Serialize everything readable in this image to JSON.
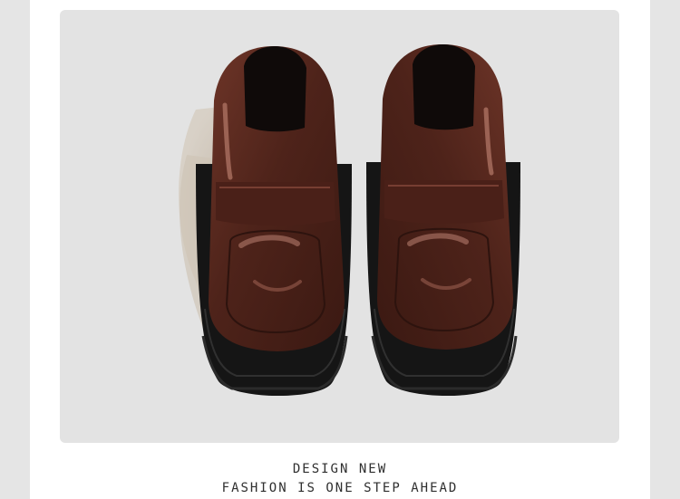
{
  "product_image": {
    "subject": "brown patent leather platform loafers",
    "colors": {
      "leather": "#5a2a1f",
      "leather_highlight": "#a86a5a",
      "sole": "#1a1a1a",
      "background": "#e3e3e3",
      "shadow": "#c9beb0"
    }
  },
  "caption": {
    "line1": "DESIGN NEW",
    "line2": "FASHION IS ONE STEP AHEAD"
  }
}
